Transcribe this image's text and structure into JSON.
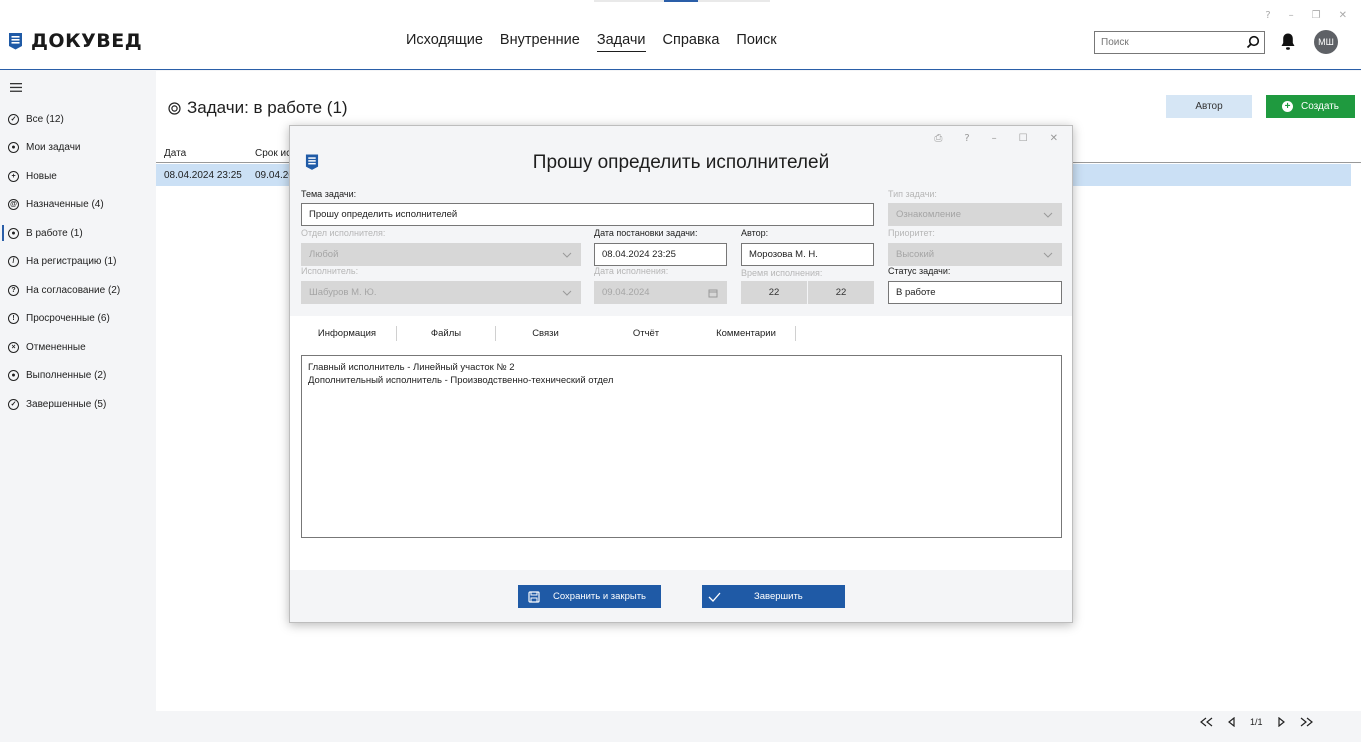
{
  "app": {
    "name": "ДОКУВЕД"
  },
  "nav": {
    "items": [
      "Исходящие",
      "Внутренние",
      "Задачи",
      "Справка",
      "Поиск"
    ],
    "active": "Задачи"
  },
  "window_controls": [
    "?",
    "–",
    "❐",
    "✕"
  ],
  "search": {
    "placeholder": "Поиск"
  },
  "user": {
    "initials": "МШ"
  },
  "sidebar": {
    "items": [
      {
        "label": "Все (12)",
        "icon": "check-circle-icon"
      },
      {
        "label": "Мои задачи",
        "icon": "person-circle-icon"
      },
      {
        "label": "Новые",
        "icon": "plus-circle-icon"
      },
      {
        "label": "Назначенные (4)",
        "icon": "at-circle-icon"
      },
      {
        "label": "В работе (1)",
        "icon": "dot-circle-icon"
      },
      {
        "label": "На регистрацию (1)",
        "icon": "pen-circle-icon"
      },
      {
        "label": "На согласование (2)",
        "icon": "question-circle-icon"
      },
      {
        "label": "Просроченные (6)",
        "icon": "exclamation-circle-icon"
      },
      {
        "label": "Отмененные",
        "icon": "x-circle-icon"
      },
      {
        "label": "Выполненные (2)",
        "icon": "filled-circle-icon"
      },
      {
        "label": "Завершенные (5)",
        "icon": "check-circle-icon"
      }
    ]
  },
  "main": {
    "title": "Задачи: в работе (1)",
    "author_button": "Автор",
    "create_button": "Создать",
    "table": {
      "headers": [
        "Дата",
        "Срок ис"
      ],
      "row": [
        "08.04.2024 23:25",
        "09.04.20"
      ]
    }
  },
  "pager": {
    "label": "1/1"
  },
  "dialog": {
    "title": "Прошу определить исполнителей",
    "controls": [
      "⎙",
      "?",
      "–",
      "☐",
      "✕"
    ],
    "topic_label": "Тема задачи:",
    "topic_value": "Прошу определить исполнителей",
    "type_label": "Тип задачи:",
    "type_value": "Ознакомление",
    "dept_label": "Отдел исполнителя:",
    "dept_value": "Любой",
    "date_set_label": "Дата постановки задачи:",
    "date_set_value": "08.04.2024 23:25",
    "author_label": "Автор:",
    "author_value": "Морозова М. Н.",
    "priority_label": "Приоритет:",
    "priority_value": "Высокий",
    "executor_label": "Исполнитель:",
    "executor_value": "Шабуров М. Ю.",
    "due_date_label": "Дата исполнения:",
    "due_date_value": "09.04.2024",
    "due_time_label": "Время исполнения:",
    "due_hour": "22",
    "due_minute": "22",
    "status_label": "Статус задачи:",
    "status_value": "В работе",
    "tabs": [
      "Информация",
      "Файлы",
      "Связи",
      "Отчёт",
      "Комментарии"
    ],
    "active_tab": "Отчёт",
    "report_lines": [
      "Главный исполнитель - Линейный участок № 2",
      "Дополнительный исполнитель - Производственно-технический отдел"
    ],
    "save_button": "Сохранить и закрыть",
    "finish_button": "Завершить"
  },
  "colors": {
    "accent": "#2a5ea8",
    "create": "#1f9a3f",
    "primary_button": "#1f5aa6",
    "selected_row": "#cbe0f5"
  }
}
